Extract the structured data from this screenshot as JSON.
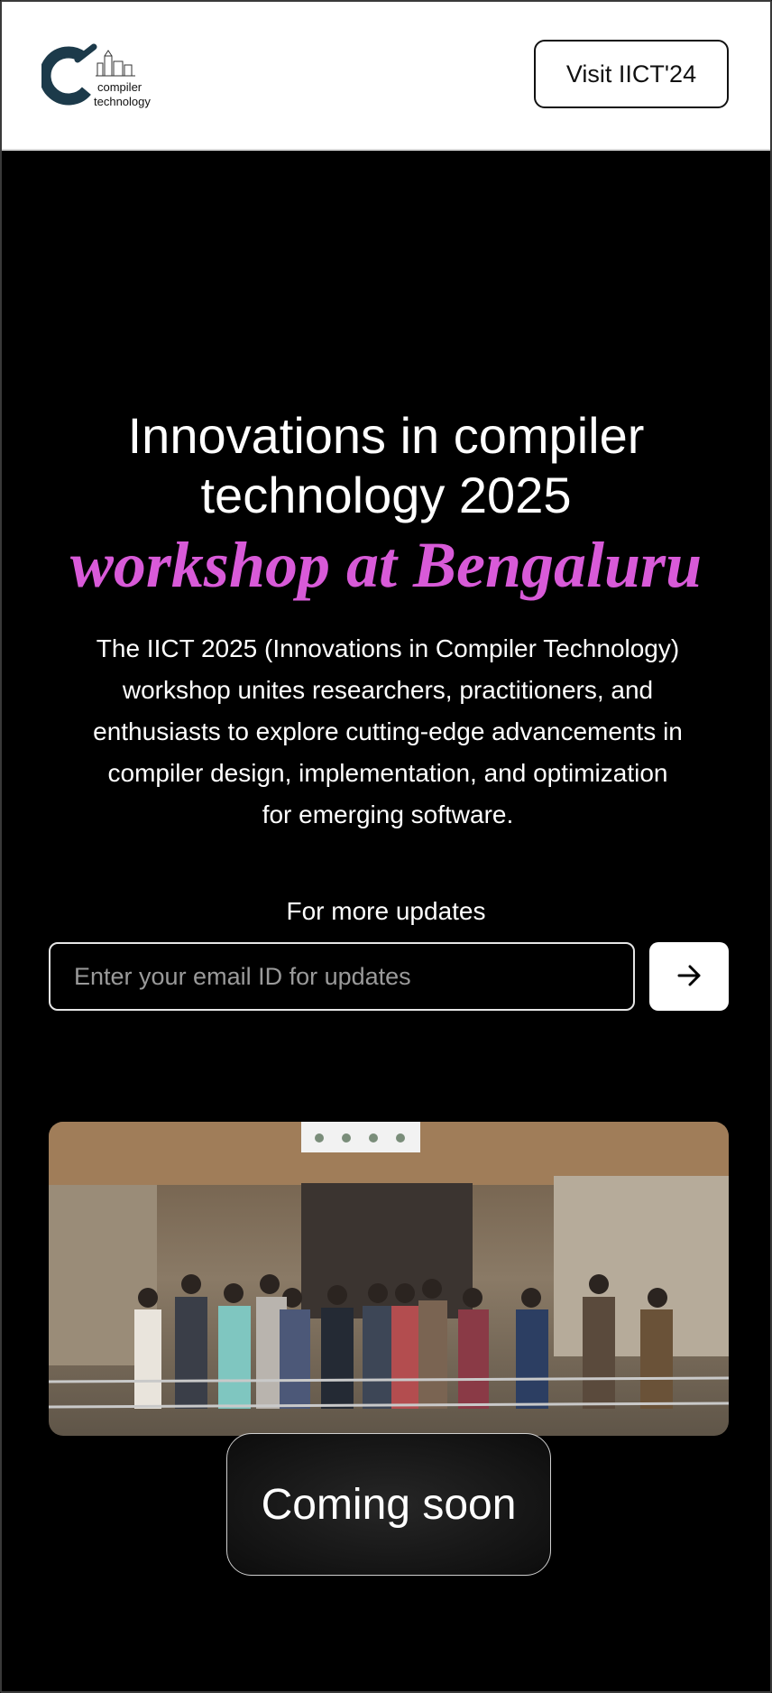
{
  "header": {
    "logo_text_line1": "compiler",
    "logo_text_line2": "technology",
    "visit_button_label": "Visit IICT'24"
  },
  "hero": {
    "title": "Innovations in compiler technology 2025",
    "subtitle": "workshop at Bengaluru",
    "description": "The IICT 2025 (Innovations in Compiler Technology) workshop unites researchers, practitioners, and enthusiasts to explore cutting-edge advancements in compiler design, implementation, and optimization for emerging software."
  },
  "updates": {
    "label": "For more updates",
    "email_placeholder": "Enter your email ID for updates",
    "email_value": "",
    "submit_icon": "arrow-right-icon"
  },
  "photo": {
    "alt": "IICT workshop group photo"
  },
  "coming_soon_label": "Coming soon",
  "colors": {
    "background": "#000000",
    "accent": "#d85ad8",
    "header_background": "#ffffff"
  }
}
